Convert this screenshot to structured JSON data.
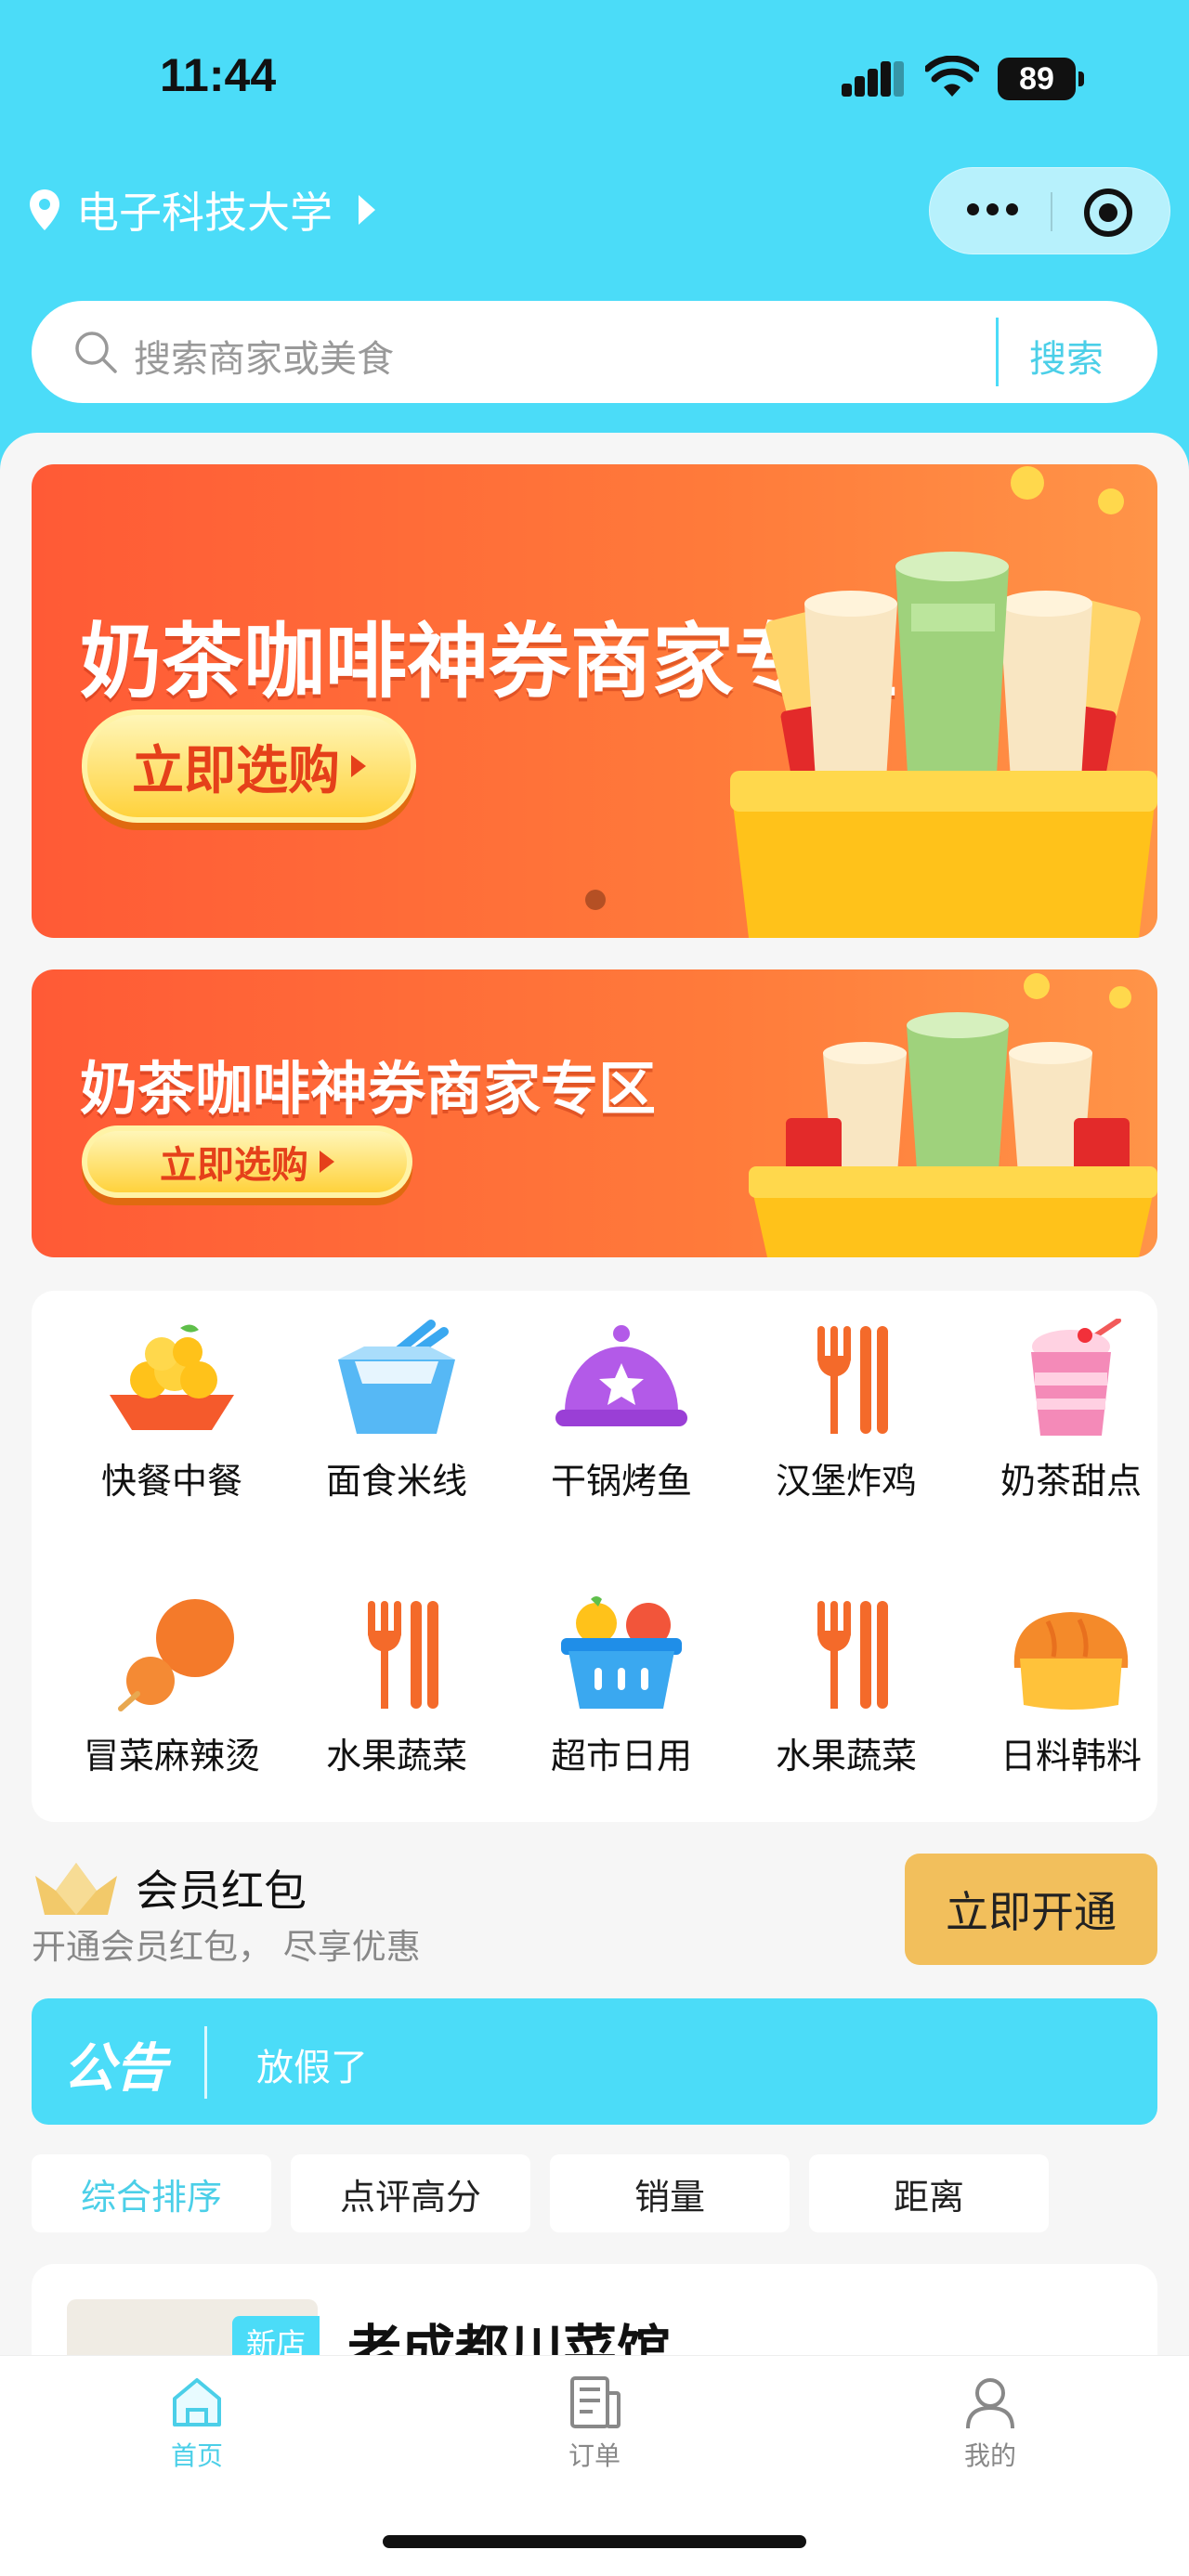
{
  "status_bar": {
    "time": "11:44",
    "battery": "89"
  },
  "header": {
    "location": "电子科技大学"
  },
  "search": {
    "placeholder": "搜索商家或美食",
    "button": "搜索"
  },
  "banners": [
    {
      "headline": "奶茶咖啡神券商家专区",
      "cta": "立即选购"
    },
    {
      "headline": "奶茶咖啡神券商家专区",
      "cta": "立即选购"
    }
  ],
  "categories": [
    {
      "label": "快餐中餐",
      "icon": "mango-bowl-icon"
    },
    {
      "label": "面食米线",
      "icon": "noodle-bowl-icon"
    },
    {
      "label": "干锅烤鱼",
      "icon": "cloche-icon"
    },
    {
      "label": "汉堡炸鸡",
      "icon": "fork-knife-icon"
    },
    {
      "label": "奶茶甜点",
      "icon": "milk-tea-icon"
    },
    {
      "label": "冒菜麻辣烫",
      "icon": "skewer-balls-icon"
    },
    {
      "label": "水果蔬菜",
      "icon": "fork-knife-icon"
    },
    {
      "label": "超市日用",
      "icon": "basket-icon"
    },
    {
      "label": "水果蔬菜",
      "icon": "fork-knife-icon"
    },
    {
      "label": "日料韩料",
      "icon": "bread-icon"
    }
  ],
  "member": {
    "title": "会员红包",
    "subtitle": "开通会员红包， 尽享优惠",
    "button": "立即开通"
  },
  "notice": {
    "tag": "公告",
    "message": "放假了"
  },
  "sort_tabs": [
    "综合排序",
    "点评高分",
    "销量",
    "距离"
  ],
  "shop": {
    "tag": "新店",
    "name": "老成都川菜馆"
  },
  "tabbar": [
    "首页",
    "订单",
    "我的"
  ],
  "colors": {
    "accent": "#4bdcf8",
    "member_button": "#f2bf5c",
    "banner": "#ff6a3a"
  }
}
